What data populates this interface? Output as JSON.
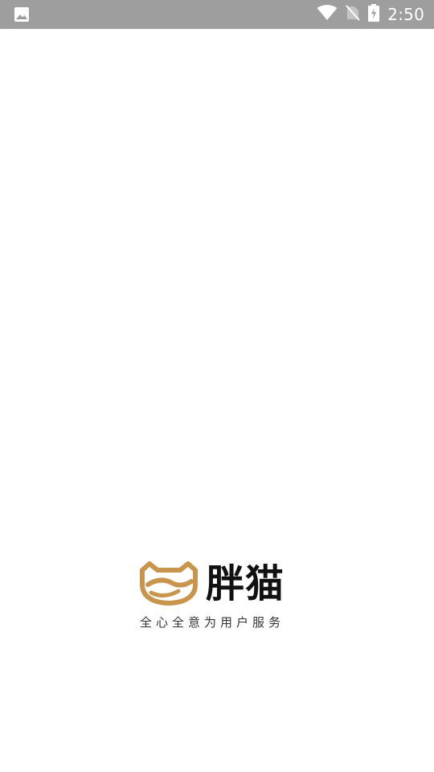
{
  "status_bar": {
    "time": "2:50",
    "left_icon": "image-notification-icon",
    "right_icons": [
      "wifi-icon",
      "no-sim-icon",
      "battery-charging-icon"
    ],
    "background": "#9e9e9e"
  },
  "splash": {
    "brand_name": "胖猫",
    "slogan": "全心全意为用户服务",
    "logo_icon": "fat-cat-logo-icon",
    "logo_color": "#c9954c",
    "background": "#ffffff"
  }
}
